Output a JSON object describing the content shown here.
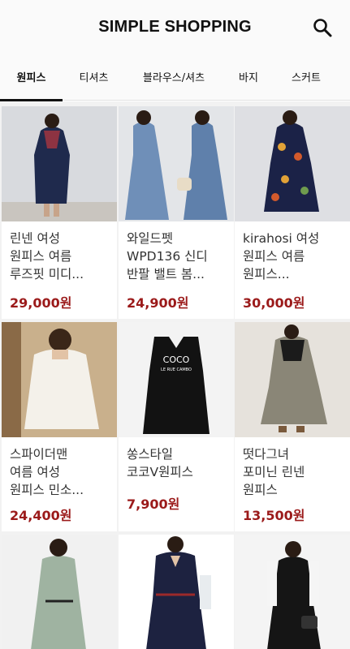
{
  "header": {
    "title": "SIMPLE SHOPPING",
    "search_icon": "search-icon"
  },
  "tabs": [
    {
      "label": "원피스",
      "active": true
    },
    {
      "label": "티셔츠",
      "active": false
    },
    {
      "label": "블라우스/셔츠",
      "active": false
    },
    {
      "label": "바지",
      "active": false
    },
    {
      "label": "스커트",
      "active": false
    }
  ],
  "products": [
    {
      "title": "린넨 여성\n원피스 여름\n루즈핏 미디...",
      "price": "29,000원"
    },
    {
      "title": "와일드펫\nWPD136 신디\n반팔 밸트 봄...",
      "price": "24,900원"
    },
    {
      "title": "kirahosi 여성\n원피스 여름\n원피스...",
      "price": "30,000원"
    },
    {
      "title": "스파이더맨\n여름 여성\n원피스 민소...",
      "price": "24,400원"
    },
    {
      "title": "쏭스타일\n코코V원피스",
      "price": "7,900원"
    },
    {
      "title": "떳다그녀\n포미닌 린넨\n원피스",
      "price": "13,500원"
    },
    {
      "title": "",
      "price": ""
    },
    {
      "title": "",
      "price": ""
    },
    {
      "title": "",
      "price": ""
    }
  ],
  "image_text": {
    "shirt_print_1": "COCO",
    "shirt_print_2": "LE RUE CAMBO"
  },
  "colors": {
    "price": "#9b1a1a",
    "title": "#333333",
    "background": "#f2f2f2"
  }
}
